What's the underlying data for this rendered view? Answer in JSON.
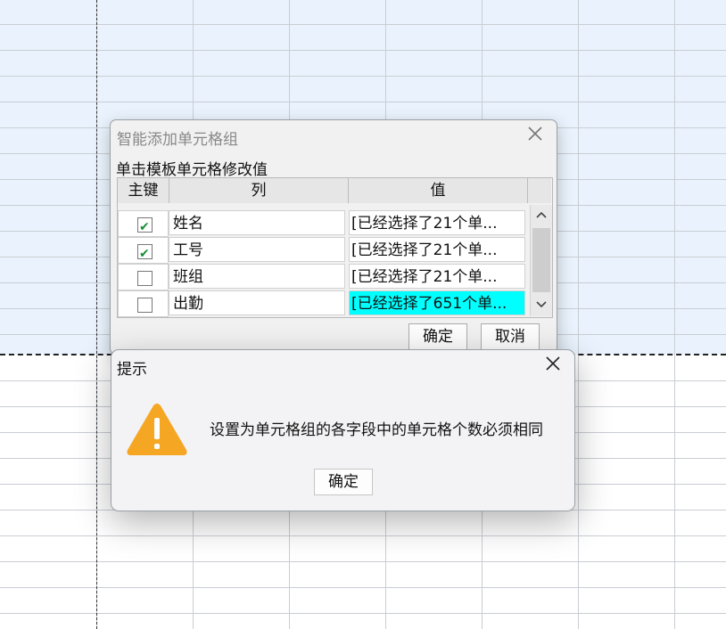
{
  "dialog_smart_add": {
    "title": "智能添加单元格组",
    "subtitle": "单击模板单元格修改值",
    "columns": {
      "key": "主键",
      "col": "列",
      "val": "值"
    },
    "rows": [
      {
        "checked": true,
        "name": "姓名",
        "value": "[已经选择了21个单..."
      },
      {
        "checked": true,
        "name": "工号",
        "value": "[已经选择了21个单..."
      },
      {
        "checked": false,
        "name": "班组",
        "value": "[已经选择了21个单..."
      },
      {
        "checked": false,
        "name": "出勤",
        "value": "[已经选择了651个单...",
        "highlight": "#00ffff"
      }
    ],
    "ok_label": "确定",
    "cancel_label": "取消",
    "close_icon": "close-icon"
  },
  "dialog_alert": {
    "title": "提示",
    "message": "设置为单元格组的各字段中的单元格个数必须相同",
    "ok_label": "确定",
    "icon": "warning-icon",
    "icon_color": "#f5a623"
  },
  "colors": {
    "sheet_selected": "#eaf3fd",
    "grid": "#c9cdd3",
    "highlight": "#00ffff"
  }
}
